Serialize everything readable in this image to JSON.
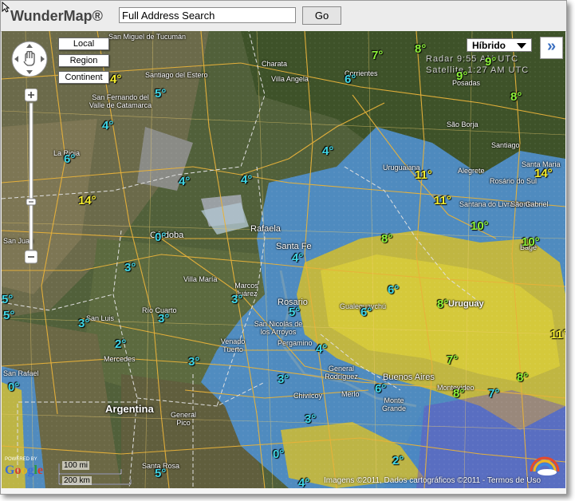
{
  "header": {
    "brand": "WunderMap®",
    "search_placeholder": "Full Address Search",
    "go_label": "Go"
  },
  "map_controls": {
    "local": "Local",
    "region": "Region",
    "continent": "Continent",
    "layer_selected": "Híbrido",
    "collapse_glyph": "»"
  },
  "radar_overlay": {
    "line1": "Radar  9:55 AM UTC",
    "line2": "Satellite  1:27 AM UTC"
  },
  "country_label": "Argentina",
  "cities": [
    "San Miguel de Tucumán",
    "Santiago del Estero",
    "San Fernando del Valle de Catamarca",
    "Charata",
    "Villa Angela",
    "Corrientes",
    "Posadas",
    "São Borja",
    "Santiago",
    "Santa Maria",
    "Uruguaiana",
    "Alegrete",
    "Rosário do Sul",
    "Santana do Livramento",
    "São Gabriel",
    "Bagé",
    "La Rioja",
    "Rafaela",
    "Santa Fe",
    "Córdoba",
    "Villa María",
    "Marcos Juárez",
    "Rosario",
    "Gualeguaychú",
    "Uruguay",
    "Río Cuarto",
    "San Luis",
    "San Nicolás de los Arroyos",
    "Pergamino",
    "Venado Tuerto",
    "Mercedes",
    "General Rodríguez",
    "Buenos Aires",
    "Merlo",
    "Monte Grande",
    "Montevideo",
    "Chivilcoy",
    "San Rafael",
    "General Pico",
    "Santa Rosa",
    "San Juan"
  ],
  "temperatures": [
    "4°",
    "5°",
    "4°",
    "6°",
    "4°",
    "4°",
    "14°",
    "0°",
    "3°",
    "3°",
    "3°",
    "2°",
    "3°",
    "3°",
    "0°",
    "5°",
    "4°",
    "5°",
    "3°",
    "4°",
    "6°",
    "6°",
    "6°",
    "7°",
    "8°",
    "7°",
    "8°",
    "9°",
    "9°",
    "8°",
    "8°",
    "8°",
    "11°",
    "11°",
    "10°",
    "10°",
    "14°",
    "11°",
    "8°",
    "6°",
    "8°",
    "2°",
    "5°",
    "3°",
    "0°",
    "4°",
    "5°",
    "7°",
    "6°",
    "4°",
    "14°"
  ],
  "temp_colors": {
    "cyan": "#3fd6e6",
    "green": "#8cf23a",
    "yellow": "#f6ee2e"
  },
  "scale": {
    "miles": "100 mi",
    "km": "200 km"
  },
  "attribution": "Imagens ©2011, Dados cartográficos ©2011 - Termos de Uso",
  "google": "Google",
  "powered_by": "POWERED BY"
}
